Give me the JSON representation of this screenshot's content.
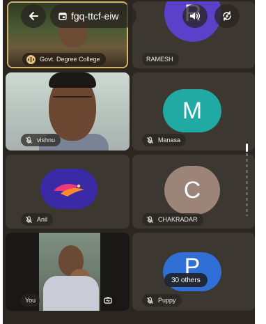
{
  "meeting": {
    "code": "fgq-ttcf-eiw"
  },
  "colors": {
    "avatar_r": "#5a41c9",
    "avatar_m": "#21a9a4",
    "avatar_c": "#9c8479",
    "avatar_p": "#2f6fd6",
    "avatar_anil": "#3a2aa6"
  },
  "tiles": [
    {
      "name": "Govt. Degree College",
      "muted": false,
      "type": "video"
    },
    {
      "name": "RAMESH",
      "initial": "R",
      "muted": false,
      "type": "avatar"
    },
    {
      "name": "vishnu",
      "muted": true,
      "type": "video"
    },
    {
      "name": "Manasa",
      "initial": "M",
      "muted": true,
      "type": "avatar"
    },
    {
      "name": "Anil",
      "muted": true,
      "type": "logo"
    },
    {
      "name": "CHAKRADAR",
      "initial": "C",
      "muted": true,
      "type": "avatar"
    },
    {
      "name": "You",
      "muted": false,
      "type": "video"
    },
    {
      "name": "Puppy",
      "initial": "P",
      "muted": true,
      "type": "avatar"
    }
  ],
  "others_count_label": "30 others",
  "icons": {
    "back": "arrow-left-icon",
    "calendar": "calendar-icon",
    "speaker": "speaker-icon",
    "switch_camera": "switch-camera-icon",
    "mic_off": "mic-off-icon",
    "audio_waves": "audio-waves-icon",
    "flip": "flip-camera-icon"
  }
}
